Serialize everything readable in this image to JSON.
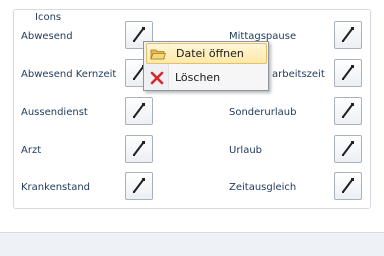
{
  "group": {
    "title": "Icons"
  },
  "rows": [
    {
      "left_label": "Abwesend",
      "right_label": "Mittagspause"
    },
    {
      "left_label": "Abwesend Kernzeit",
      "right_label": "arbeitszeit"
    },
    {
      "left_label": "Aussendienst",
      "right_label": "Sonderurlaub"
    },
    {
      "left_label": "Arzt",
      "right_label": "Urlaub"
    },
    {
      "left_label": "Krankenstand",
      "right_label": "Zeitausgleich"
    }
  ],
  "context_menu": {
    "items": [
      {
        "label": "Datei öffnen",
        "icon": "open-folder-icon",
        "highlighted": true
      },
      {
        "label": "Löschen",
        "icon": "delete-x-icon",
        "highlighted": false
      }
    ]
  },
  "colors": {
    "label_text": "#1e395b",
    "menu_highlight": "#ffe9a8",
    "delete_icon": "#d9262b",
    "folder_icon": "#e8b84a"
  }
}
